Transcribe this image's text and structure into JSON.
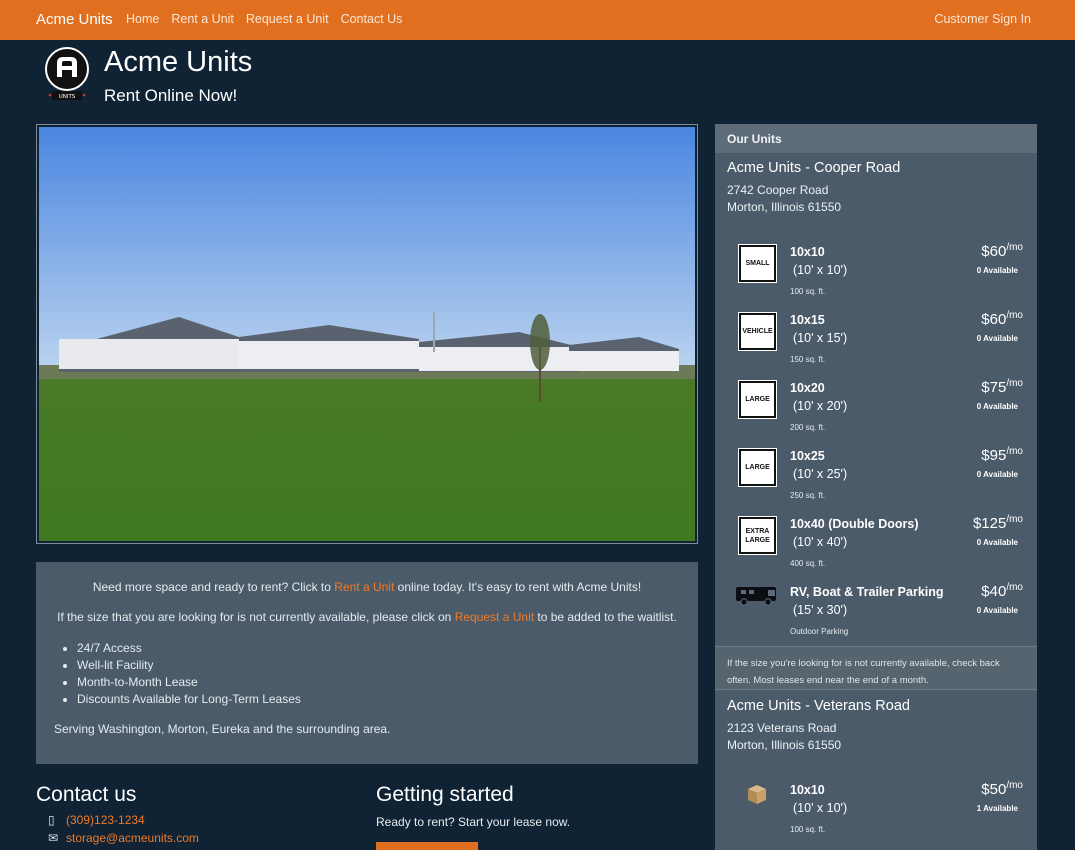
{
  "nav": {
    "brand": "Acme Units",
    "links": [
      "Home",
      "Rent a Unit",
      "Request a Unit",
      "Contact Us"
    ],
    "signin": "Customer Sign In"
  },
  "header": {
    "title": "Acme Units",
    "subtitle": "Rent Online Now!",
    "logo_text": "UNITS"
  },
  "info": {
    "line1_pre": "Need more space and ready to rent? Click to ",
    "line1_link": "Rent a Unit",
    "line1_post": " online today. It's easy to rent with Acme Units!",
    "line2_pre": "If the size that you are looking for is not currently available, please click on ",
    "line2_link": "Request a Unit",
    "line2_post": " to be added to the waitlist.",
    "features": [
      "24/7 Access",
      "Well-lit Facility",
      "Month-to-Month Lease",
      "Discounts Available for Long-Term Leases"
    ],
    "serving": "Serving Washington, Morton, Eureka and the surrounding area."
  },
  "contact": {
    "heading": "Contact us",
    "phone": "(309)123-1234",
    "email": "storage@acmeunits.com"
  },
  "getting_started": {
    "heading": "Getting started",
    "text": "Ready to rent? Start your lease now."
  },
  "sidebar": {
    "heading": "Our Units",
    "locations": [
      {
        "name": "Acme Units - Cooper Road",
        "address1": "2742 Cooper Road",
        "address2": "Morton, Illinois 61550",
        "units": [
          {
            "badge": "SMALL",
            "title": "10x10",
            "dims": "(10' x 10')",
            "area": "100 sq. ft.",
            "price": "$60",
            "per": "/mo",
            "avail": "0 Available"
          },
          {
            "badge": "VEHICLE",
            "title": "10x15",
            "dims": "(10' x 15')",
            "area": "150 sq. ft.",
            "price": "$60",
            "per": "/mo",
            "avail": "0 Available"
          },
          {
            "badge": "LARGE",
            "title": "10x20",
            "dims": "(10' x 20')",
            "area": "200 sq. ft.",
            "price": "$75",
            "per": "/mo",
            "avail": "0 Available"
          },
          {
            "badge": "LARGE",
            "title": "10x25",
            "dims": "(10' x 25')",
            "area": "250 sq. ft.",
            "price": "$95",
            "per": "/mo",
            "avail": "0 Available"
          },
          {
            "badge": "EXTRA LARGE",
            "title": "10x40 (Double Doors)",
            "dims": "(10' x 40')",
            "area": "400 sq. ft.",
            "price": "$125",
            "per": "/mo",
            "avail": "0 Available"
          },
          {
            "badge": "",
            "title": "RV, Boat & Trailer Parking",
            "dims": "(15' x 30')",
            "area": "Outdoor Parking",
            "price": "$40",
            "per": "/mo",
            "avail": "0 Available"
          }
        ],
        "note": "If the size you're looking for is not currently available, check back often. Most leases end near the end of a month."
      },
      {
        "name": "Acme Units - Veterans Road",
        "address1": "2123 Veterans Road",
        "address2": "Morton, Illinois 61550",
        "units": [
          {
            "badge": "",
            "title": "10x10",
            "dims": "(10' x 10')",
            "area": "100 sq. ft.",
            "price": "$50",
            "per": "/mo",
            "avail": "1 Available"
          }
        ]
      }
    ]
  }
}
